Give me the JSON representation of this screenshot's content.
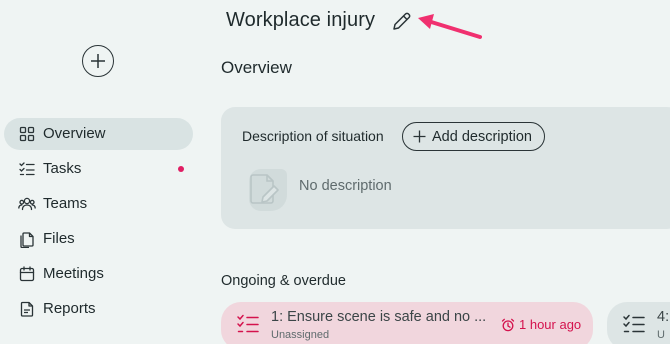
{
  "header": {
    "title": "Workplace injury",
    "edit_icon": "pencil-icon"
  },
  "sidebar": {
    "add_icon": "plus-icon",
    "items": [
      {
        "label": "Overview",
        "icon": "grid-icon",
        "active": true
      },
      {
        "label": "Tasks",
        "icon": "checklist-icon",
        "has_notification": true
      },
      {
        "label": "Teams",
        "icon": "people-icon"
      },
      {
        "label": "Files",
        "icon": "files-icon"
      },
      {
        "label": "Meetings",
        "icon": "calendar-icon"
      },
      {
        "label": "Reports",
        "icon": "document-icon"
      }
    ]
  },
  "main": {
    "section_title": "Overview",
    "description": {
      "label": "Description of situation",
      "add_button": "Add description",
      "empty_text": "No description"
    },
    "ongoing": {
      "title": "Ongoing & overdue",
      "tasks": [
        {
          "name": "1: Ensure scene is safe and no ...",
          "assignee": "Unassigned",
          "due": "1 hour ago",
          "overdue": true
        },
        {
          "name": "4:",
          "assignee": "U"
        }
      ]
    }
  },
  "colors": {
    "background": "#eff4f3",
    "active_nav": "#d9e3e3",
    "card": "#dde5e5",
    "overdue_card": "#f1d6dd",
    "overdue_text": "#d4124d",
    "notification_dot": "#e01e63",
    "annotation_arrow": "#f0306f"
  }
}
